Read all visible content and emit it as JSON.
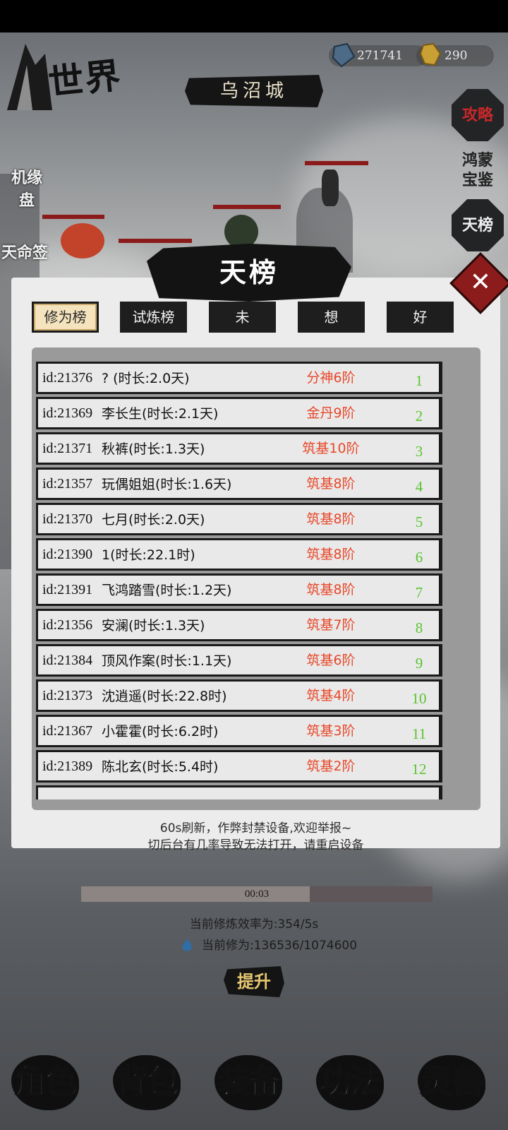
{
  "header": {
    "world_title": "世界",
    "city_name": "乌沼城",
    "spirit_stones": "271741",
    "gold": "290"
  },
  "side_right": [
    {
      "label": "攻略",
      "color": "#c8282a"
    },
    {
      "label": "鸿蒙\n宝鉴",
      "color": "#eeeeee"
    },
    {
      "label": "天榜",
      "color": "#eeeeee"
    }
  ],
  "side_left": {
    "fortune_disk": "机缘\n盘",
    "fate_lot": "天命签"
  },
  "modal": {
    "title": "天榜",
    "close_icon": "close-icon",
    "tabs": [
      "修为榜",
      "试炼榜",
      "未",
      "想",
      "好"
    ],
    "active_tab": 0,
    "rows": [
      {
        "uid": "id:21376",
        "name": "?  (时长:2.0天)",
        "realm": "分神6阶",
        "rank": "1"
      },
      {
        "uid": "id:21369",
        "name": "李长生(时长:2.1天)",
        "realm": "金丹9阶",
        "rank": "2"
      },
      {
        "uid": "id:21371",
        "name": "秋裤(时长:1.3天)",
        "realm": "筑基10阶",
        "rank": "3"
      },
      {
        "uid": "id:21357",
        "name": "玩偶姐姐(时长:1.6天)",
        "realm": "筑基8阶",
        "rank": "4"
      },
      {
        "uid": "id:21370",
        "name": "七月(时长:2.0天)",
        "realm": "筑基8阶",
        "rank": "5"
      },
      {
        "uid": "id:21390",
        "name": "1(时长:22.1时)",
        "realm": "筑基8阶",
        "rank": "6"
      },
      {
        "uid": "id:21391",
        "name": "飞鸿踏雪(时长:1.2天)",
        "realm": "筑基8阶",
        "rank": "7"
      },
      {
        "uid": "id:21356",
        "name": "安澜(时长:1.3天)",
        "realm": "筑基7阶",
        "rank": "8"
      },
      {
        "uid": "id:21384",
        "name": "顶风作案(时长:1.1天)",
        "realm": "筑基6阶",
        "rank": "9"
      },
      {
        "uid": "id:21373",
        "name": "沈逍遥(时长:22.8时)",
        "realm": "筑基4阶",
        "rank": "10"
      },
      {
        "uid": "id:21367",
        "name": "小霍霍(时长:6.2时)",
        "realm": "筑基3阶",
        "rank": "11"
      },
      {
        "uid": "id:21389",
        "name": "陈北玄(时长:5.4时)",
        "realm": "筑基2阶",
        "rank": "12"
      }
    ],
    "notice_line1": "60s刷新，作弊封禁设备,欢迎举报~",
    "notice_line2": "切后台有几率导致无法打开，请重启设备"
  },
  "cultivation": {
    "timer": "00:03",
    "progress_fraction": 0.65,
    "efficiency": "当前修炼效率为:354/5s",
    "current": "当前修为:136536/1074600",
    "upgrade_label": "提升"
  },
  "bottom_nav": [
    "角色",
    "背包",
    "装备",
    "功法",
    "灵兽"
  ]
}
